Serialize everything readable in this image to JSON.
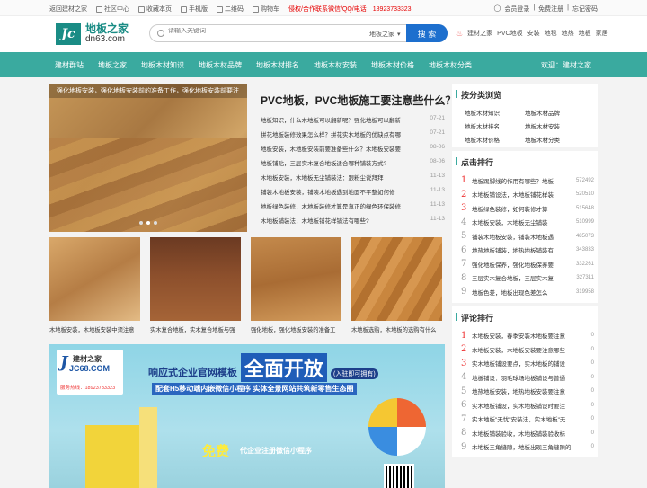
{
  "topbar": {
    "links": [
      "返回建材之家",
      "社区中心",
      "收藏本页",
      "手机版",
      "二维码",
      "购物车"
    ],
    "promo": "侵权/合作联系微信/QQ/电话：18923733323",
    "login": "会员登录",
    "register": "免费注册",
    "forgot": "忘记密码"
  },
  "header": {
    "logo_mark": "Jc",
    "logo_cn": "地板之家",
    "logo_en": "dn63.com",
    "search_placeholder": "请输入关键词",
    "search_scope": "地板之家",
    "search_button": "搜 索",
    "hot_tags": [
      "建材之家",
      "PVC地板",
      "安装",
      "地毯",
      "地热",
      "地板",
      "家居"
    ]
  },
  "nav": {
    "items": [
      "建材群站",
      "地板之家",
      "地板木材知识",
      "地板木材品牌",
      "地板木材排名",
      "地板木材安装",
      "地板木材价格",
      "地板木材分类"
    ],
    "welcome": "欢迎：建材之家"
  },
  "slider": {
    "caption": "强化地板安装，强化地板安装前的准备工作，强化地板安装前要注"
  },
  "news": {
    "title": "PVC地板，PVC地板施工要注意些什么？",
    "items": [
      {
        "title": "地板知识，什么木地板可以翻新呢？强化地板可以翻新",
        "date": "07-21"
      },
      {
        "title": "拼花地板装修效果怎么样？拼花实木地板的优缺点有哪",
        "date": "07-21"
      },
      {
        "title": "地板安装，木地板安装前要准备些什么？木地板安装要",
        "date": "08-06"
      },
      {
        "title": "地板铺贴，三层实木复合地板适合哪种铺装方式?",
        "date": "08-06"
      },
      {
        "title": "木地板安装，木地板无尘铺装法：跟粉尘说拜拜",
        "date": "11-13"
      },
      {
        "title": "铺装木地板安装，铺装木地板遇到地面不平整如何修",
        "date": "11-13"
      },
      {
        "title": "地板绿色装修，木地板装修才算是真正的绿色环保装修",
        "date": "11-13"
      },
      {
        "title": "木地板铺装法，木地板铺花样铺法有哪些?",
        "date": "11-13"
      }
    ]
  },
  "thumbs": [
    {
      "caption": "木地板安装，木地板安装中须注意"
    },
    {
      "caption": "实木复合地板，实木复合地板与强"
    },
    {
      "caption": "强化地板，强化地板安装的准备工"
    },
    {
      "caption": "木地板选购，木地板的选购有什么"
    }
  ],
  "banner": {
    "logo_name": "建材之家",
    "logo_site": "JC68.COM",
    "logo_phone": "服务热线：18923733323",
    "headline_a": "响应式企业官网模板",
    "headline_b": "全面开放",
    "headline_c": "(入驻即可拥有)",
    "subline": "配套H5移动端内嵌微信小程序 实体全景网站共筑新零售生态圈",
    "free": "免费",
    "free_sub": "代企业注册微信小程序"
  },
  "sidebar": {
    "browse_title": "按分类浏览",
    "browse_items": [
      "地板木材知识",
      "地板木材品牌",
      "地板木材排名",
      "地板木材安装",
      "地板木材价格",
      "地板木材分类"
    ],
    "click_title": "点击排行",
    "click_items": [
      {
        "rank": "1",
        "title": "地板踢脚线的作用有哪些？地板",
        "count": "572492"
      },
      {
        "rank": "2",
        "title": "木地板铺设法，木地板铺花样装",
        "count": "520510"
      },
      {
        "rank": "3",
        "title": "地板绿色装修，如何装修才算",
        "count": "515648"
      },
      {
        "rank": "4",
        "title": "木地板安装，木地板无尘铺装",
        "count": "510999"
      },
      {
        "rank": "5",
        "title": "铺装木地板安装，铺装木地板遇",
        "count": "485073"
      },
      {
        "rank": "6",
        "title": "地热地板铺装，地热地板铺装有",
        "count": "343833"
      },
      {
        "rank": "7",
        "title": "强化地板保养，强化地板保养要",
        "count": "332261"
      },
      {
        "rank": "8",
        "title": "三层实木复合地板，三层实木复",
        "count": "327311"
      },
      {
        "rank": "9",
        "title": "地板色差，地板出现色差怎么",
        "count": "319958"
      }
    ],
    "comment_title": "评论排行",
    "comment_items": [
      {
        "rank": "1",
        "title": "木地板安装，春季安装木地板要注意",
        "count": "0"
      },
      {
        "rank": "2",
        "title": "木地板安装，木地板安装要注意哪些",
        "count": "0"
      },
      {
        "rank": "3",
        "title": "实木地板铺设要点，实木地板的铺设",
        "count": "0"
      },
      {
        "rank": "4",
        "title": "地板铺设：羽毛球场地板铺设与普通",
        "count": "0"
      },
      {
        "rank": "5",
        "title": "地热地板安装，地热地板安装要注意",
        "count": "0"
      },
      {
        "rank": "6",
        "title": "实木地板铺设，实木地板铺设时要注",
        "count": "0"
      },
      {
        "rank": "7",
        "title": "实木地板\"无忧\"安装法，实木地板\"无",
        "count": "0"
      },
      {
        "rank": "8",
        "title": "木地板铺装验收，木地板铺装验收标",
        "count": "0"
      },
      {
        "rank": "9",
        "title": "木地板三角缝隙，地板出现三角缝隙的",
        "count": "0"
      }
    ]
  }
}
